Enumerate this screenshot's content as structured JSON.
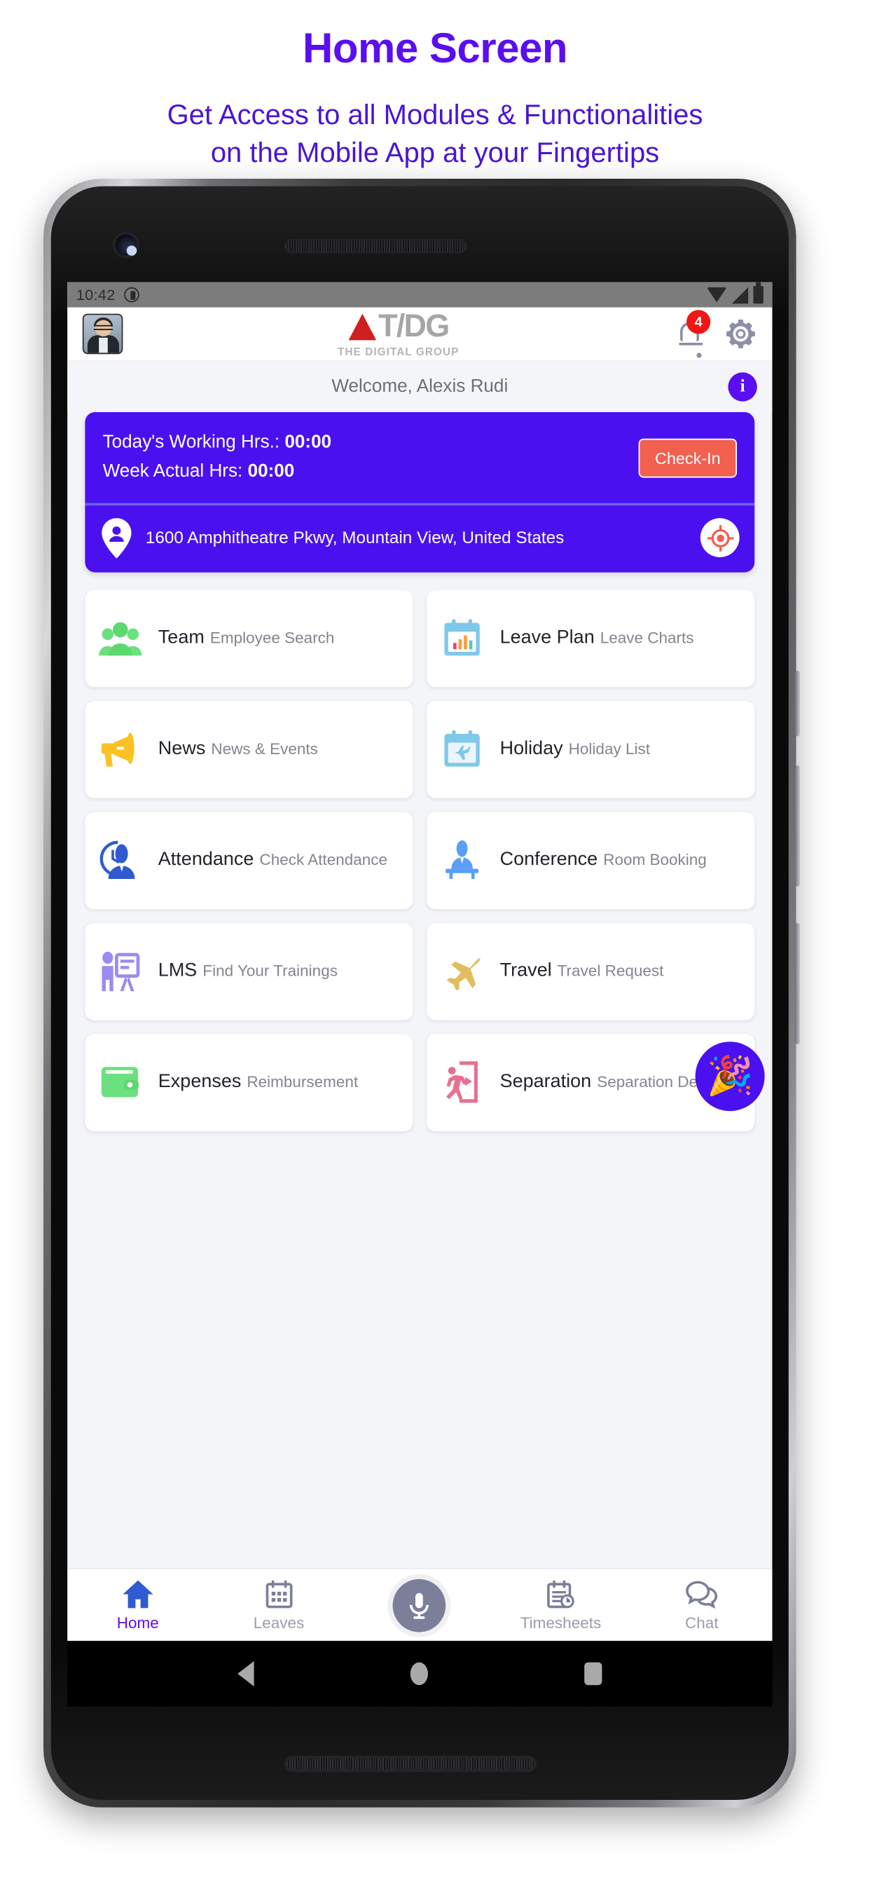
{
  "promo": {
    "title": "Home Screen",
    "subtitle_line1": "Get Access to all Modules & Functionalities",
    "subtitle_line2": "on the Mobile App at your Fingertips",
    "title_color": "#5b0ef0",
    "subtitle_color": "#4a14d6"
  },
  "status_bar": {
    "time": "10:42",
    "icons": [
      "dnd-icon",
      "wifi-icon",
      "signal-icon",
      "battery-icon"
    ]
  },
  "app_bar": {
    "avatar_name": "avatar",
    "logo_text": "T/DG",
    "logo_tagline": "THE DIGITAL GROUP",
    "notification_count": "4",
    "settings_icon": "gear-icon"
  },
  "welcome": {
    "text": "Welcome, Alexis Rudi",
    "info_icon": "i"
  },
  "hours_card": {
    "today_label": "Today's Working Hrs.:",
    "today_value": "00:00",
    "week_label": "Week Actual Hrs:",
    "week_value": "00:00",
    "checkin_label": "Check-In",
    "checkin_color": "#f2604f",
    "card_color": "#4a10f0",
    "location": "1600 Amphitheatre Pkwy, Mountain View, United States",
    "location_icon": "location-pin-icon",
    "gps_icon": "gps-target-icon"
  },
  "modules": [
    {
      "title": "Team",
      "subtitle": "Employee Search",
      "icon": "team-icon",
      "color": "#6ce07e"
    },
    {
      "title": "Leave Plan",
      "subtitle": "Leave Charts",
      "icon": "leave-chart-icon",
      "color": "#7fc8ea"
    },
    {
      "title": "News",
      "subtitle": "News & Events",
      "icon": "megaphone-icon",
      "color": "#fcc123"
    },
    {
      "title": "Holiday",
      "subtitle": "Holiday List",
      "icon": "holiday-plane-icon",
      "color": "#7fc8ea"
    },
    {
      "title": "Attendance",
      "subtitle": "Check Attendance",
      "icon": "attendance-icon",
      "color": "#2f5ad0"
    },
    {
      "title": "Conference",
      "subtitle": "Room Booking",
      "icon": "conference-icon",
      "color": "#5a9ef7"
    },
    {
      "title": "LMS",
      "subtitle": "Find Your Trainings",
      "icon": "lms-board-icon",
      "color": "#9b8bf0"
    },
    {
      "title": "Travel",
      "subtitle": "Travel Request",
      "icon": "travel-plane-icon",
      "color": "#e2bd5e"
    },
    {
      "title": "Expenses",
      "subtitle": "Reimbursement",
      "icon": "wallet-icon",
      "color": "#6ce07e"
    },
    {
      "title": "Separation",
      "subtitle": "Separation Details",
      "icon": "exit-door-icon",
      "color": "#e8708f"
    }
  ],
  "celebration": {
    "emoji": "🎉"
  },
  "bottom_nav": [
    {
      "label": "Home",
      "icon": "home-icon",
      "active": true
    },
    {
      "label": "Leaves",
      "icon": "calendar-icon",
      "active": false
    },
    {
      "label": "",
      "icon": "microphone-icon",
      "active": false
    },
    {
      "label": "Timesheets",
      "icon": "timesheet-icon",
      "active": false
    },
    {
      "label": "Chat",
      "icon": "chat-icon",
      "active": false
    }
  ],
  "android_keys": [
    "back-key",
    "home-key",
    "recents-key"
  ]
}
